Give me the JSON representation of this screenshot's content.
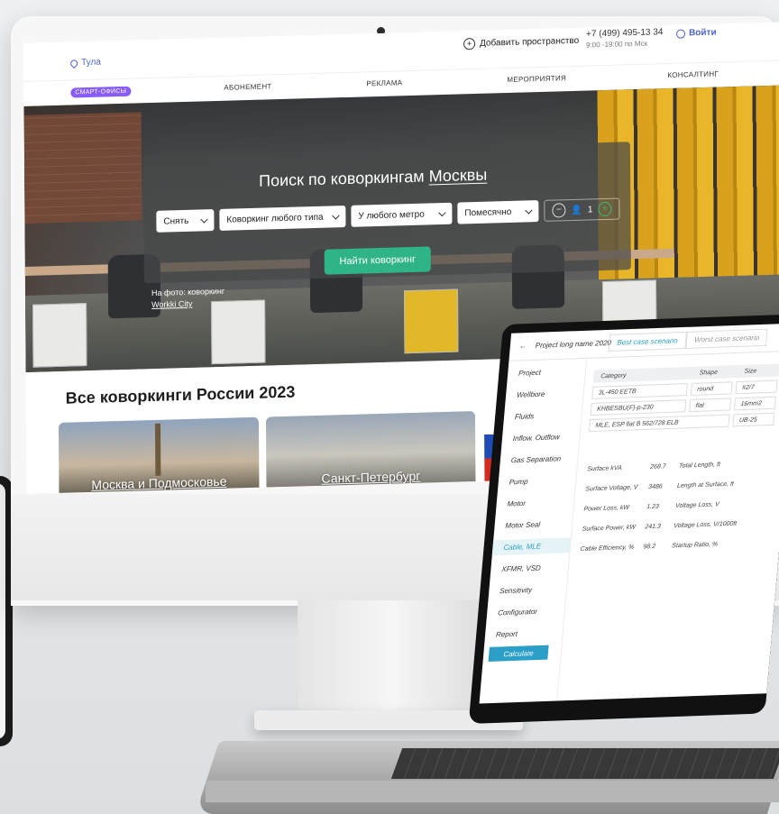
{
  "site": {
    "city": "Тула",
    "add_space": "Добавить пространство",
    "phone": "+7 (499) 495-13 34",
    "hours": "9:00 -19:00 по Мск",
    "login": "Войти",
    "nav": {
      "badge": "СМАРТ-ОФИСЫ",
      "items": [
        "АБОНЕМЕНТ",
        "РЕКЛАМА",
        "МЕРОПРИЯТИЯ",
        "КОНСАЛТИНГ"
      ]
    },
    "hero": {
      "title_prefix": "Поиск по коворкингам",
      "title_city": "Москвы",
      "filters": [
        "Снять",
        "Коворкинг любого типа",
        "У любого метро",
        "Помесячно"
      ],
      "guests_count": "1",
      "cta": "Найти коворкинг",
      "caption_line1": "На фото: коворкинг",
      "caption_line2": "Workki City"
    },
    "section_title": "Все коворкинги России 2023",
    "cards": [
      "Москва и Подмосковье",
      "Санкт-Петербург"
    ]
  },
  "app": {
    "back": "←",
    "project_name": "Project long name 2020",
    "tabs": [
      "Best case scenario",
      "Worst case scenario"
    ],
    "sidebar": [
      "Project",
      "Wellbore",
      "Fluids",
      "Inflow, Outflow",
      "Gas Separation",
      "Pump",
      "Motor",
      "Motor Seal",
      "Cable, MLE",
      "XFMR, VSD",
      "Sensitivity",
      "Configurator",
      "Report"
    ],
    "active_item": "Cable, MLE",
    "calculate": "Calculate",
    "table": {
      "headers": [
        "Category",
        "Shape",
        "Size"
      ],
      "rows": [
        [
          "3L-450 EETB",
          "round",
          "#2/7"
        ],
        [
          "KHBESBU(F)-p-230",
          "flat",
          "16mm2"
        ],
        [
          "MLE, ESP flat B 562/728 ELB",
          "",
          "UB-25"
        ]
      ]
    },
    "stats": [
      [
        "Surface kVA",
        "268.7",
        "Total Length, ft"
      ],
      [
        "Surface Voltage, V",
        "3486",
        "Length at Surface, ft"
      ],
      [
        "Power Loss, kW",
        "1.23",
        "Voltage Loss, V"
      ],
      [
        "Surface Power, kW",
        "241.3",
        "Voltage Loss, V/1000ft"
      ],
      [
        "Cable Efficiency, %",
        "98.2",
        "Startup Ratio, %"
      ]
    ]
  }
}
